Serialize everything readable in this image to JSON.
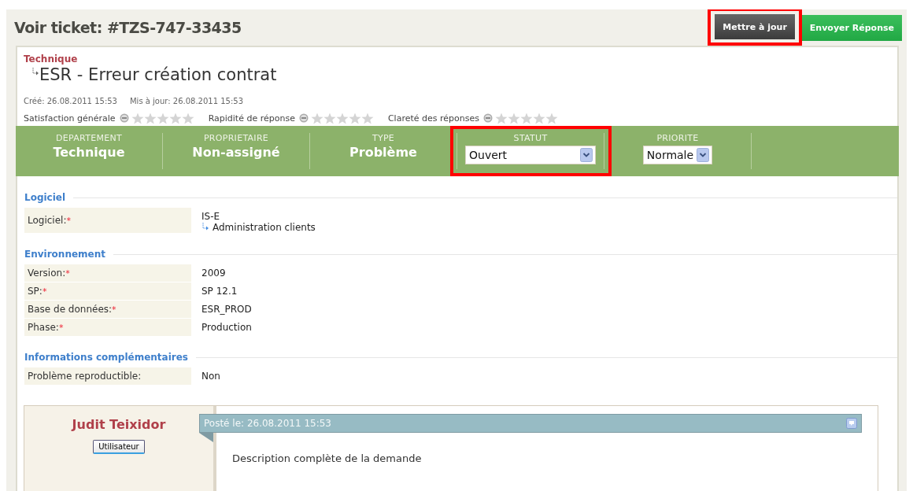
{
  "header": {
    "title": "Voir ticket: #TZS-747-33435",
    "buttons": [
      {
        "kind": "dark",
        "label": "Mettre à jour",
        "highlighted": true
      },
      {
        "kind": "green",
        "label": "Envoyer Réponse",
        "highlighted": false
      }
    ]
  },
  "ticket": {
    "category": "Technique",
    "subject": "ESR - Erreur création contrat",
    "created": "Créé: 26.08.2011 15:53",
    "updated": "Mis à jour: 26.08.2011 15:53",
    "ratings": [
      {
        "label": "Satisfaction générale",
        "stars": 0
      },
      {
        "label": "Rapidité de réponse",
        "stars": 0
      },
      {
        "label": "Clareté des réponses",
        "stars": 0
      }
    ]
  },
  "properties": [
    {
      "kind": "text",
      "label": "DEPARTEMENT",
      "value": "Technique",
      "highlighted": false
    },
    {
      "kind": "text",
      "label": "PROPRIETAIRE",
      "value": "Non-assigné",
      "highlighted": false
    },
    {
      "kind": "text",
      "label": "TYPE",
      "value": "Problème",
      "highlighted": false
    },
    {
      "kind": "select",
      "label": "STATUT",
      "value": "Ouvert",
      "highlighted": true
    },
    {
      "kind": "select",
      "label": "PRIORITE",
      "value": "Normale",
      "highlighted": false
    }
  ],
  "sections": [
    {
      "title": "Logiciel",
      "fields": [
        {
          "label": "Logiciel:",
          "mark": "*",
          "value": "IS-E",
          "sub_value": "Administration clients"
        }
      ]
    },
    {
      "title": "Environnement",
      "fields": [
        {
          "label": "Version:",
          "mark": "*",
          "value": "2009"
        },
        {
          "label": "SP:",
          "mark": "*",
          "value": "SP 12.1"
        },
        {
          "label": "Base de données:",
          "mark": "*",
          "value": "ESR_PROD"
        },
        {
          "label": "Phase:",
          "mark": "*",
          "value": "Production"
        }
      ]
    },
    {
      "title": "Informations complémentaires",
      "fields": [
        {
          "label": "Problème reproductible:",
          "value": "Non"
        }
      ]
    }
  ],
  "post": {
    "author": "Judit Teixidor",
    "role": "Utilisateur",
    "posted": "Posté le: 26.08.2011 15:53",
    "body": "Description complète de la demande"
  }
}
